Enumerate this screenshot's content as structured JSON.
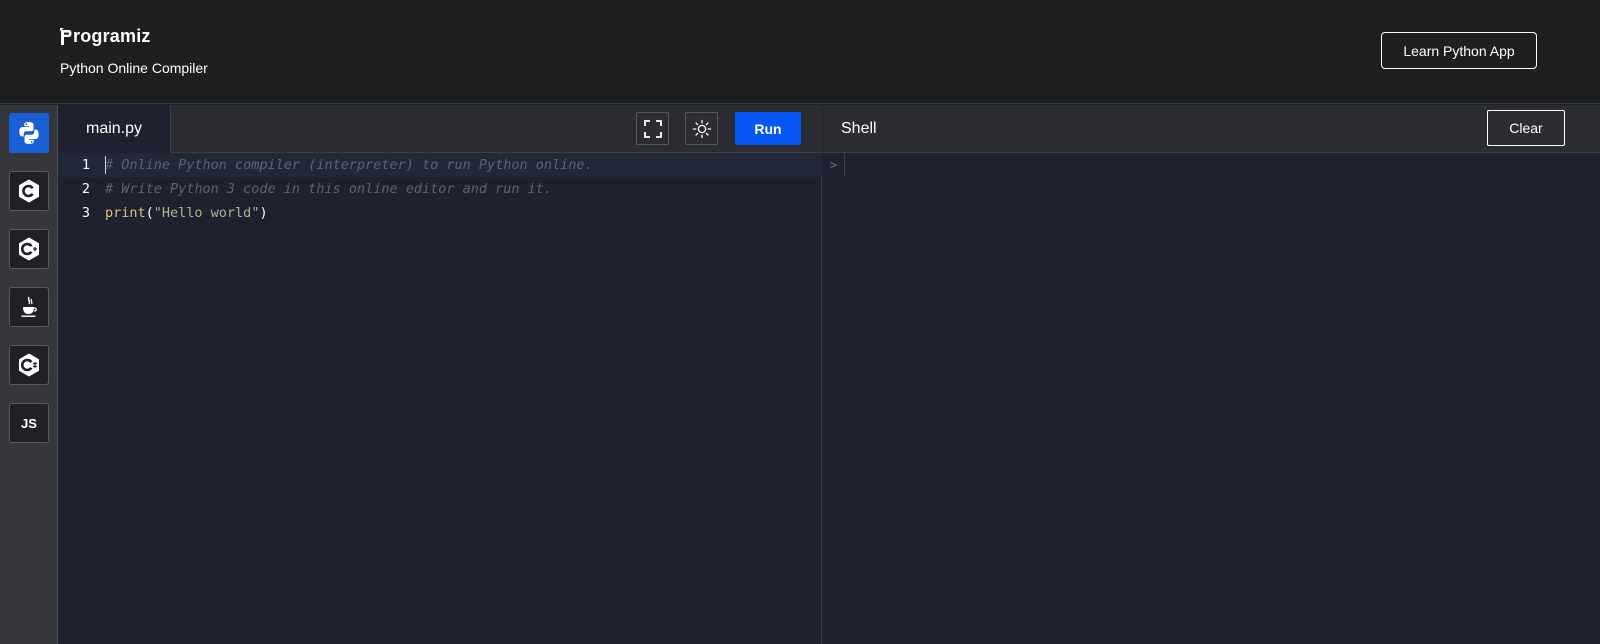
{
  "header": {
    "brand": "rogramiz",
    "subtitle": "Python Online Compiler",
    "learn_button": "Learn Python App"
  },
  "sidebar": {
    "languages": [
      {
        "id": "python",
        "icon": "python-icon",
        "active": true
      },
      {
        "id": "c",
        "icon": "c-icon",
        "active": false
      },
      {
        "id": "cpp",
        "icon": "cpp-icon",
        "active": false
      },
      {
        "id": "java",
        "icon": "java-icon",
        "active": false
      },
      {
        "id": "csharp",
        "icon": "csharp-icon",
        "active": false
      },
      {
        "id": "javascript",
        "icon": "js-icon",
        "label": "JS",
        "active": false
      }
    ]
  },
  "editor": {
    "file_tab": "main.py",
    "run_label": "Run",
    "lines": [
      {
        "num": "1",
        "text": "# Online Python compiler (interpreter) to run Python online."
      },
      {
        "num": "2",
        "text": "# Write Python 3 code in this online editor and run it."
      },
      {
        "num": "3",
        "fn": "print",
        "open": "(",
        "str": "\"Hello world\"",
        "close": ")"
      }
    ]
  },
  "shell": {
    "title": "Shell",
    "clear_label": "Clear",
    "prompt": ">"
  },
  "colors": {
    "accent": "#0556f3",
    "active_language": "#1a5fd6",
    "background": "#1d2130",
    "header": "#1e1f21"
  }
}
